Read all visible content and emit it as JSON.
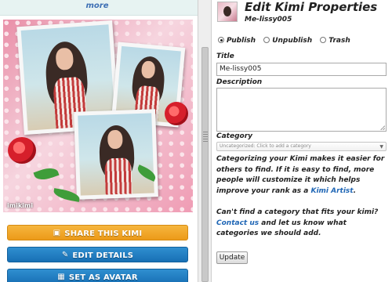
{
  "left_panel": {
    "more_link": "more",
    "watermark": "imikimi",
    "buttons": {
      "share": "SHARE THIS KIMI",
      "edit": "EDIT DETAILS",
      "avatar": "SET AS AVATAR"
    }
  },
  "editor": {
    "title": "Edit Kimi Properties",
    "subtitle": "Me-lissy005",
    "visibility": {
      "options": [
        "Publish",
        "Unpublish",
        "Trash"
      ],
      "selected": "Publish"
    },
    "title_label": "Title",
    "title_value": "Me-lissy005",
    "description_label": "Description",
    "description_value": "",
    "category_label": "Category",
    "category_placeholder": "Uncategorized: Click to add a category",
    "help_text_1a": "Categorizing your Kimi makes it easier for others to find. If it is easy to find, more people will customize it which helps improve your rank as a ",
    "help_link_1": "Kimi Artist",
    "help_text_1b": ".",
    "help_text_2a": "Can't find a category that fits your kimi?",
    "help_link_2": "Contact us",
    "help_text_2b": " and let us know what categories we should add.",
    "update_button": "Update"
  },
  "colors": {
    "share_button": "#ec9a19",
    "blue_button": "#1870b5",
    "link": "#1f66b5",
    "more_link": "#3d6fb4"
  },
  "icons": {
    "share": "photo-share-icon",
    "edit": "pencil-icon",
    "avatar": "picture-icon"
  }
}
